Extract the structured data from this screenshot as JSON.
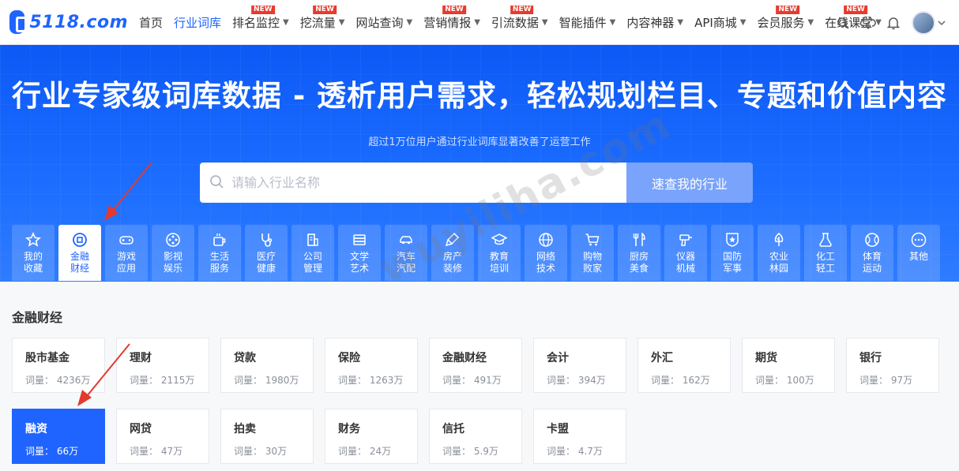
{
  "nav": {
    "logo_text": "5118.com",
    "items": [
      {
        "label": "首页",
        "caret": false,
        "new": false,
        "active": false
      },
      {
        "label": "行业词库",
        "caret": false,
        "new": false,
        "active": true
      },
      {
        "label": "排名监控",
        "caret": true,
        "new": true,
        "active": false
      },
      {
        "label": "挖流量",
        "caret": true,
        "new": true,
        "active": false
      },
      {
        "label": "网站查询",
        "caret": true,
        "new": false,
        "active": false
      },
      {
        "label": "营销情报",
        "caret": true,
        "new": true,
        "active": false
      },
      {
        "label": "引流数据",
        "caret": true,
        "new": true,
        "active": false
      },
      {
        "label": "智能插件",
        "caret": true,
        "new": false,
        "active": false
      },
      {
        "label": "内容神器",
        "caret": true,
        "new": false,
        "active": false
      },
      {
        "label": "API商城",
        "caret": true,
        "new": false,
        "active": false
      },
      {
        "label": "会员服务",
        "caret": true,
        "new": true,
        "active": false
      },
      {
        "label": "在线课堂",
        "caret": true,
        "new": true,
        "active": false
      }
    ],
    "new_badge": "NEW"
  },
  "hero": {
    "title": "行业专家级词库数据 - 透析用户需求，轻松规划栏目、专题和价值内容",
    "subtitle": "超过1万位用户通过行业词库显著改善了运营工作",
    "search_placeholder": "请输入行业名称",
    "search_button": "速查我的行业"
  },
  "categories": [
    {
      "l1": "我的",
      "l2": "收藏",
      "icon": "star-icon",
      "active": false
    },
    {
      "l1": "金融",
      "l2": "财经",
      "icon": "coin-icon",
      "active": true
    },
    {
      "l1": "游戏",
      "l2": "应用",
      "icon": "gamepad-icon",
      "active": false
    },
    {
      "l1": "影视",
      "l2": "娱乐",
      "icon": "film-reel-icon",
      "active": false
    },
    {
      "l1": "生活",
      "l2": "服务",
      "icon": "cup-icon",
      "active": false
    },
    {
      "l1": "医疗",
      "l2": "健康",
      "icon": "stethoscope-icon",
      "active": false
    },
    {
      "l1": "公司",
      "l2": "管理",
      "icon": "building-icon",
      "active": false
    },
    {
      "l1": "文学",
      "l2": "艺术",
      "icon": "book-stack-icon",
      "active": false
    },
    {
      "l1": "汽车",
      "l2": "汽配",
      "icon": "car-icon",
      "active": false
    },
    {
      "l1": "房产",
      "l2": "装修",
      "icon": "brush-icon",
      "active": false
    },
    {
      "l1": "教育",
      "l2": "培训",
      "icon": "graduation-cap-icon",
      "active": false
    },
    {
      "l1": "网络",
      "l2": "技术",
      "icon": "globe-icon",
      "active": false
    },
    {
      "l1": "购物",
      "l2": "败家",
      "icon": "cart-icon",
      "active": false
    },
    {
      "l1": "厨房",
      "l2": "美食",
      "icon": "utensils-icon",
      "active": false
    },
    {
      "l1": "仪器",
      "l2": "机械",
      "icon": "drill-icon",
      "active": false
    },
    {
      "l1": "国防",
      "l2": "军事",
      "icon": "badge-star-icon",
      "active": false
    },
    {
      "l1": "农业",
      "l2": "林园",
      "icon": "tree-icon",
      "active": false
    },
    {
      "l1": "化工",
      "l2": "轻工",
      "icon": "flask-icon",
      "active": false
    },
    {
      "l1": "体育",
      "l2": "运动",
      "icon": "ball-icon",
      "active": false
    },
    {
      "l1": "其他",
      "l2": "",
      "icon": "more-icon",
      "active": false
    }
  ],
  "section": {
    "title": "金融财经",
    "cards": [
      {
        "name": "股市基金",
        "count": "词量： 4236万",
        "active": false
      },
      {
        "name": "理财",
        "count": "词量： 2115万",
        "active": false
      },
      {
        "name": "贷款",
        "count": "词量： 1980万",
        "active": false
      },
      {
        "name": "保险",
        "count": "词量： 1263万",
        "active": false
      },
      {
        "name": "金融财经",
        "count": "词量： 491万",
        "active": false
      },
      {
        "name": "会计",
        "count": "词量： 394万",
        "active": false
      },
      {
        "name": "外汇",
        "count": "词量： 162万",
        "active": false
      },
      {
        "name": "期货",
        "count": "词量： 100万",
        "active": false
      },
      {
        "name": "银行",
        "count": "词量： 97万",
        "active": false
      },
      {
        "name": "融资",
        "count": "词量： 66万",
        "active": true
      },
      {
        "name": "网贷",
        "count": "词量： 47万",
        "active": false
      },
      {
        "name": "拍卖",
        "count": "词量： 30万",
        "active": false
      },
      {
        "name": "财务",
        "count": "词量： 24万",
        "active": false
      },
      {
        "name": "信托",
        "count": "词量： 5.9万",
        "active": false
      },
      {
        "name": "卡盟",
        "count": "词量： 4.7万",
        "active": false
      }
    ]
  },
  "watermark": "wuyiliha.com",
  "colors": {
    "brand": "#1f64ff",
    "new_badge": "#e63b2e",
    "annotation_arrow": "#e23a2f"
  }
}
